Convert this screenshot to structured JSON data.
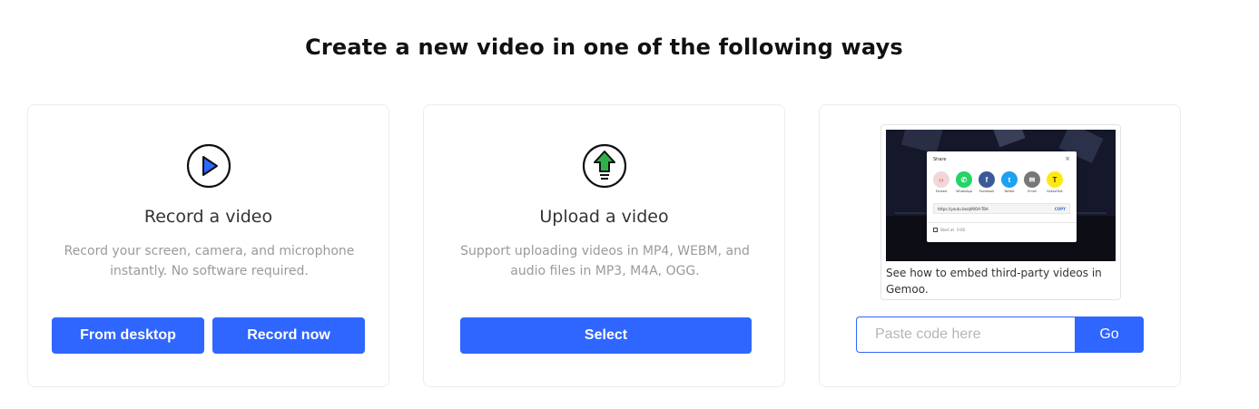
{
  "page": {
    "title": "Create a new video in one of the following ways"
  },
  "record_card": {
    "icon": "play-circle-icon",
    "title": "Record a video",
    "description": "Record your screen, camera, and microphone instantly. No software required.",
    "desktop_button": "From desktop",
    "record_button": "Record now"
  },
  "upload_card": {
    "icon": "upload-arrow-icon",
    "title": "Upload a video",
    "description": "Support uploading videos in MP4, WEBM, and audio files in MP3, M4A, OGG.",
    "select_button": "Select"
  },
  "embed_card": {
    "caption": "See how to embed third-party videos in Gemoo.",
    "input_placeholder": "Paste code here",
    "input_value": "",
    "go_button": "Go",
    "share_preview": {
      "title": "Share",
      "close": "×",
      "items": [
        {
          "label": "Embed",
          "icon": "embed-icon",
          "color": "#f1d7d7",
          "glyph": "‹›"
        },
        {
          "label": "WhatsApp",
          "icon": "whatsapp-icon",
          "color": "#25d366",
          "glyph": "✆"
        },
        {
          "label": "Facebook",
          "icon": "facebook-icon",
          "color": "#3b5998",
          "glyph": "f"
        },
        {
          "label": "Twitter",
          "icon": "twitter-icon",
          "color": "#1da1f2",
          "glyph": "t"
        },
        {
          "label": "Email",
          "icon": "email-icon",
          "color": "#777777",
          "glyph": "✉"
        },
        {
          "label": "KakaoTalk",
          "icon": "kakaotalk-icon",
          "color": "#ffe812",
          "glyph": "T"
        }
      ],
      "url": "https://youtu.be/q90OA-TBA",
      "copy": "COPY",
      "start_at_label": "Start at",
      "start_at_value": "0:00"
    }
  },
  "colors": {
    "primary": "#2f66ff",
    "upload_arrow": "#2fb14a",
    "play": "#2f66ff"
  }
}
